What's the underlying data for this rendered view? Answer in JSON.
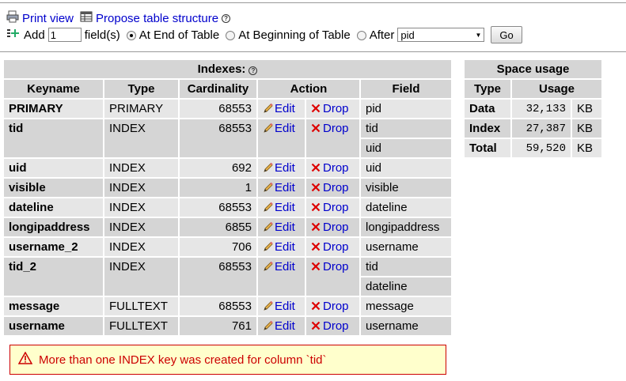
{
  "toolbar": {
    "print_view": "Print view",
    "propose_structure": "Propose table structure"
  },
  "add_columns": {
    "add_label": "Add",
    "count_value": "1",
    "fields_label": "field(s)",
    "at_end": "At End of Table",
    "at_beginning": "At Beginning of Table",
    "after": "After",
    "after_selected": "pid",
    "go": "Go"
  },
  "indexes": {
    "title": "Indexes:",
    "headers": {
      "keyname": "Keyname",
      "type": "Type",
      "cardinality": "Cardinality",
      "action": "Action",
      "field": "Field"
    },
    "edit_label": "Edit",
    "drop_label": "Drop",
    "rows": [
      {
        "keyname": "PRIMARY",
        "type": "PRIMARY",
        "cardinality": "68553",
        "fields": [
          "pid"
        ]
      },
      {
        "keyname": "tid",
        "type": "INDEX",
        "cardinality": "68553",
        "fields": [
          "tid",
          "uid"
        ]
      },
      {
        "keyname": "uid",
        "type": "INDEX",
        "cardinality": "692",
        "fields": [
          "uid"
        ]
      },
      {
        "keyname": "visible",
        "type": "INDEX",
        "cardinality": "1",
        "fields": [
          "visible"
        ]
      },
      {
        "keyname": "dateline",
        "type": "INDEX",
        "cardinality": "68553",
        "fields": [
          "dateline"
        ]
      },
      {
        "keyname": "longipaddress",
        "type": "INDEX",
        "cardinality": "6855",
        "fields": [
          "longipaddress"
        ]
      },
      {
        "keyname": "username_2",
        "type": "INDEX",
        "cardinality": "706",
        "fields": [
          "username"
        ]
      },
      {
        "keyname": "tid_2",
        "type": "INDEX",
        "cardinality": "68553",
        "fields": [
          "tid",
          "dateline"
        ]
      },
      {
        "keyname": "message",
        "type": "FULLTEXT",
        "cardinality": "68553",
        "fields": [
          "message"
        ]
      },
      {
        "keyname": "username",
        "type": "FULLTEXT",
        "cardinality": "761",
        "fields": [
          "username"
        ]
      }
    ]
  },
  "space_usage": {
    "title": "Space usage",
    "headers": {
      "type": "Type",
      "usage": "Usage"
    },
    "rows": [
      {
        "label": "Data",
        "value": "32,133",
        "unit": "KB"
      },
      {
        "label": "Index",
        "value": "27,387",
        "unit": "KB"
      },
      {
        "label": "Total",
        "value": "59,520",
        "unit": "KB"
      }
    ]
  },
  "warning": {
    "text": "More than one INDEX key was created for column `tid`"
  },
  "colors": {
    "link": "#0000cc",
    "header_bg": "#d5d5d5",
    "row_light": "#e6e6e6",
    "warning_bg": "#ffffcc",
    "warning_border": "#cc0000"
  }
}
